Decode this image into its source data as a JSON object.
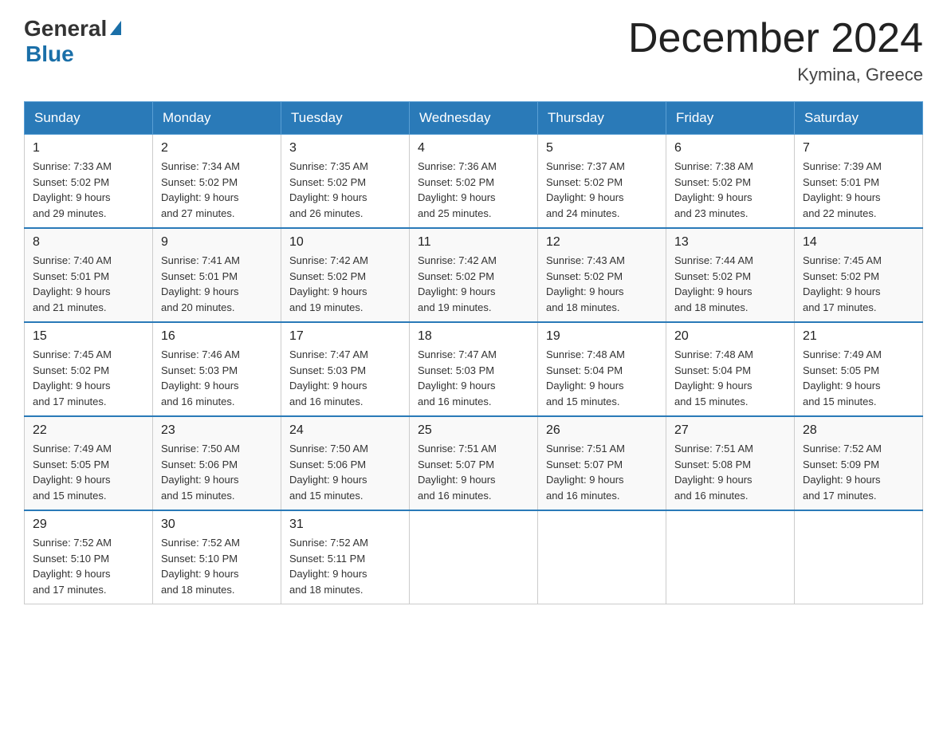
{
  "logo": {
    "general": "General",
    "blue": "Blue"
  },
  "header": {
    "month": "December 2024",
    "location": "Kymina, Greece"
  },
  "days_of_week": [
    "Sunday",
    "Monday",
    "Tuesday",
    "Wednesday",
    "Thursday",
    "Friday",
    "Saturday"
  ],
  "weeks": [
    [
      {
        "day": "1",
        "sunrise": "7:33 AM",
        "sunset": "5:02 PM",
        "daylight": "9 hours and 29 minutes."
      },
      {
        "day": "2",
        "sunrise": "7:34 AM",
        "sunset": "5:02 PM",
        "daylight": "9 hours and 27 minutes."
      },
      {
        "day": "3",
        "sunrise": "7:35 AM",
        "sunset": "5:02 PM",
        "daylight": "9 hours and 26 minutes."
      },
      {
        "day": "4",
        "sunrise": "7:36 AM",
        "sunset": "5:02 PM",
        "daylight": "9 hours and 25 minutes."
      },
      {
        "day": "5",
        "sunrise": "7:37 AM",
        "sunset": "5:02 PM",
        "daylight": "9 hours and 24 minutes."
      },
      {
        "day": "6",
        "sunrise": "7:38 AM",
        "sunset": "5:02 PM",
        "daylight": "9 hours and 23 minutes."
      },
      {
        "day": "7",
        "sunrise": "7:39 AM",
        "sunset": "5:01 PM",
        "daylight": "9 hours and 22 minutes."
      }
    ],
    [
      {
        "day": "8",
        "sunrise": "7:40 AM",
        "sunset": "5:01 PM",
        "daylight": "9 hours and 21 minutes."
      },
      {
        "day": "9",
        "sunrise": "7:41 AM",
        "sunset": "5:01 PM",
        "daylight": "9 hours and 20 minutes."
      },
      {
        "day": "10",
        "sunrise": "7:42 AM",
        "sunset": "5:02 PM",
        "daylight": "9 hours and 19 minutes."
      },
      {
        "day": "11",
        "sunrise": "7:42 AM",
        "sunset": "5:02 PM",
        "daylight": "9 hours and 19 minutes."
      },
      {
        "day": "12",
        "sunrise": "7:43 AM",
        "sunset": "5:02 PM",
        "daylight": "9 hours and 18 minutes."
      },
      {
        "day": "13",
        "sunrise": "7:44 AM",
        "sunset": "5:02 PM",
        "daylight": "9 hours and 18 minutes."
      },
      {
        "day": "14",
        "sunrise": "7:45 AM",
        "sunset": "5:02 PM",
        "daylight": "9 hours and 17 minutes."
      }
    ],
    [
      {
        "day": "15",
        "sunrise": "7:45 AM",
        "sunset": "5:02 PM",
        "daylight": "9 hours and 17 minutes."
      },
      {
        "day": "16",
        "sunrise": "7:46 AM",
        "sunset": "5:03 PM",
        "daylight": "9 hours and 16 minutes."
      },
      {
        "day": "17",
        "sunrise": "7:47 AM",
        "sunset": "5:03 PM",
        "daylight": "9 hours and 16 minutes."
      },
      {
        "day": "18",
        "sunrise": "7:47 AM",
        "sunset": "5:03 PM",
        "daylight": "9 hours and 16 minutes."
      },
      {
        "day": "19",
        "sunrise": "7:48 AM",
        "sunset": "5:04 PM",
        "daylight": "9 hours and 15 minutes."
      },
      {
        "day": "20",
        "sunrise": "7:48 AM",
        "sunset": "5:04 PM",
        "daylight": "9 hours and 15 minutes."
      },
      {
        "day": "21",
        "sunrise": "7:49 AM",
        "sunset": "5:05 PM",
        "daylight": "9 hours and 15 minutes."
      }
    ],
    [
      {
        "day": "22",
        "sunrise": "7:49 AM",
        "sunset": "5:05 PM",
        "daylight": "9 hours and 15 minutes."
      },
      {
        "day": "23",
        "sunrise": "7:50 AM",
        "sunset": "5:06 PM",
        "daylight": "9 hours and 15 minutes."
      },
      {
        "day": "24",
        "sunrise": "7:50 AM",
        "sunset": "5:06 PM",
        "daylight": "9 hours and 15 minutes."
      },
      {
        "day": "25",
        "sunrise": "7:51 AM",
        "sunset": "5:07 PM",
        "daylight": "9 hours and 16 minutes."
      },
      {
        "day": "26",
        "sunrise": "7:51 AM",
        "sunset": "5:07 PM",
        "daylight": "9 hours and 16 minutes."
      },
      {
        "day": "27",
        "sunrise": "7:51 AM",
        "sunset": "5:08 PM",
        "daylight": "9 hours and 16 minutes."
      },
      {
        "day": "28",
        "sunrise": "7:52 AM",
        "sunset": "5:09 PM",
        "daylight": "9 hours and 17 minutes."
      }
    ],
    [
      {
        "day": "29",
        "sunrise": "7:52 AM",
        "sunset": "5:10 PM",
        "daylight": "9 hours and 17 minutes."
      },
      {
        "day": "30",
        "sunrise": "7:52 AM",
        "sunset": "5:10 PM",
        "daylight": "9 hours and 18 minutes."
      },
      {
        "day": "31",
        "sunrise": "7:52 AM",
        "sunset": "5:11 PM",
        "daylight": "9 hours and 18 minutes."
      },
      null,
      null,
      null,
      null
    ]
  ],
  "labels": {
    "sunrise": "Sunrise:",
    "sunset": "Sunset:",
    "daylight": "Daylight:"
  }
}
